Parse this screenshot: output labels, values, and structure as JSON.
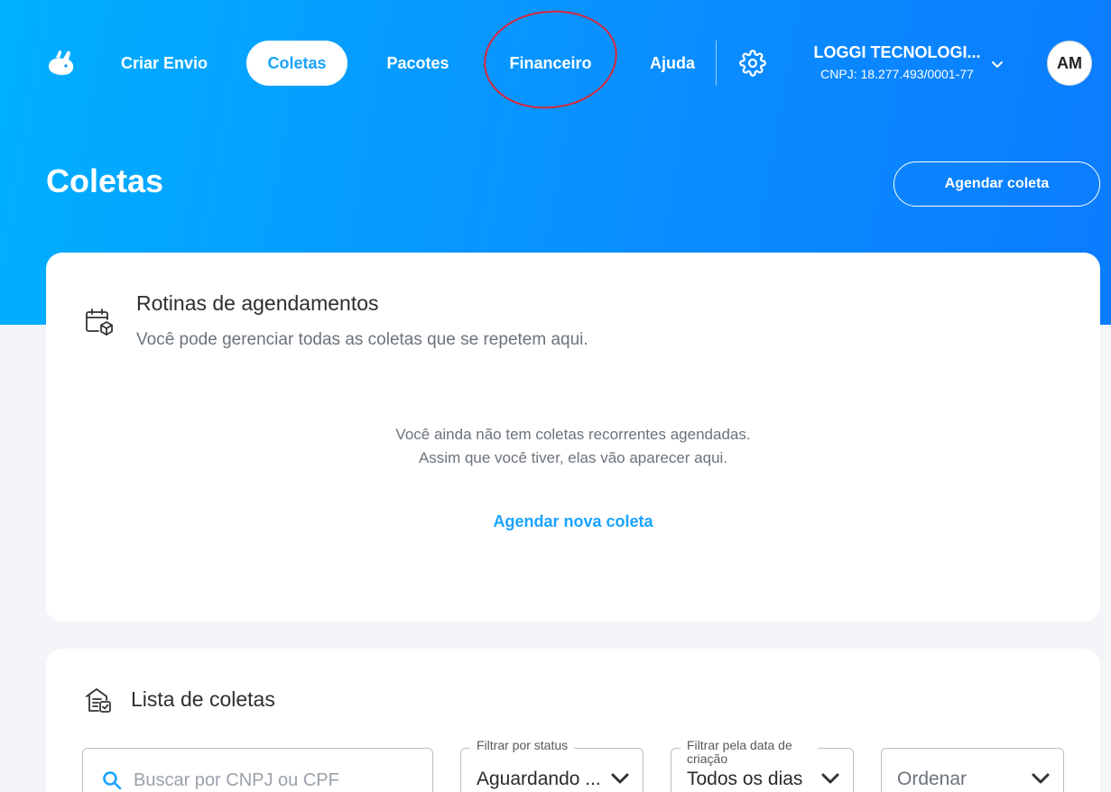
{
  "nav": {
    "items": [
      {
        "label": "Criar Envio"
      },
      {
        "label": "Coletas"
      },
      {
        "label": "Pacotes"
      },
      {
        "label": "Financeiro"
      },
      {
        "label": "Ajuda"
      }
    ],
    "active_index": 1,
    "company_name": "LOGGI TECNOLOGI...",
    "company_cnpj": "CNPJ: 18.277.493/0001-77",
    "avatar_initials": "AM"
  },
  "page": {
    "title": "Coletas",
    "primary_action": "Agendar coleta"
  },
  "routines": {
    "title": "Rotinas de agendamentos",
    "subtitle": "Você pode gerenciar todas as coletas que se repetem aqui.",
    "empty_line1": "Você ainda não tem coletas recorrentes agendadas.",
    "empty_line2": "Assim que você tiver, elas vão aparecer aqui.",
    "link": "Agendar nova coleta"
  },
  "list": {
    "title": "Lista de coletas",
    "search_placeholder": "Buscar por CNPJ ou CPF",
    "status_filter": {
      "legend": "Filtrar por status",
      "value": "Aguardando ..."
    },
    "date_filter": {
      "legend": "Filtrar pela data de criação",
      "value": "Todos os dias"
    },
    "order": {
      "placeholder": "Ordenar"
    }
  },
  "colors": {
    "brand_blue": "#1aa3ff",
    "annotation_red": "#d8283a"
  },
  "icons": {
    "logo": "loggi-rabbit-icon",
    "settings": "gear-icon",
    "routines": "calendar-package-icon",
    "list": "warehouse-list-icon",
    "search": "search-icon",
    "dropdown": "chevron-down-icon"
  }
}
